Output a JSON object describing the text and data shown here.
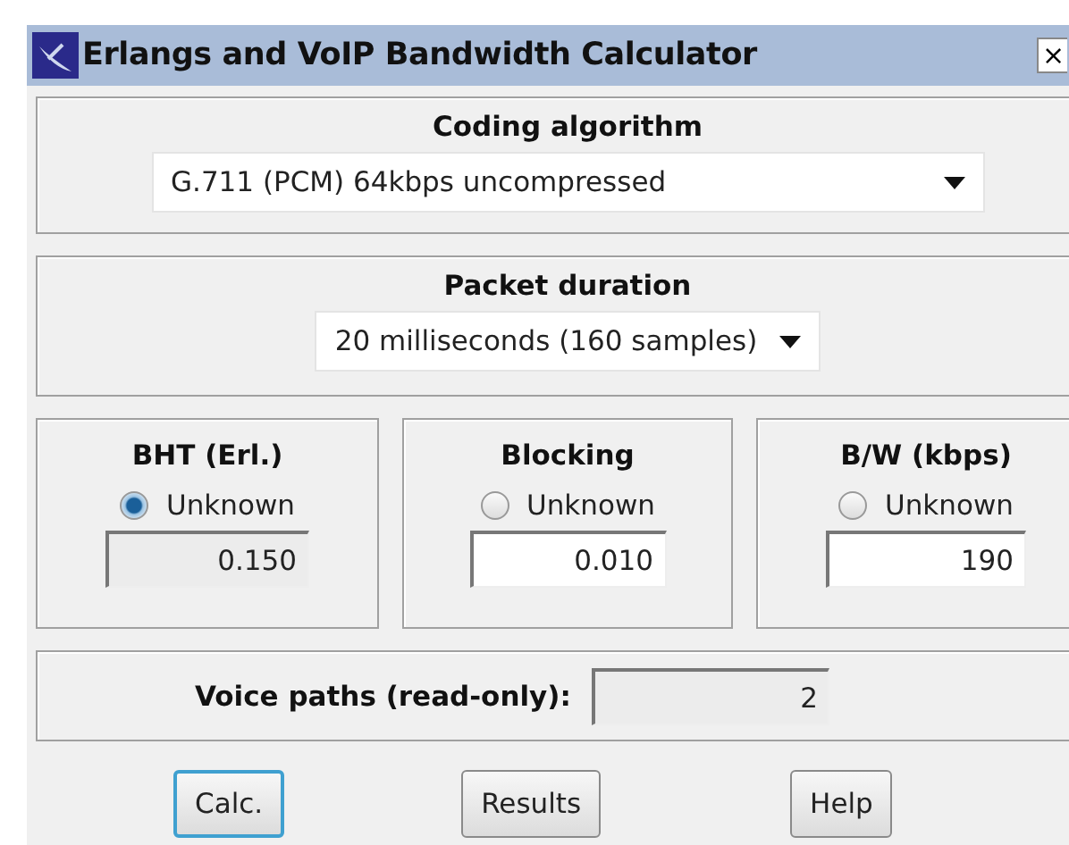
{
  "window": {
    "title": "Erlangs and VoIP Bandwidth Calculator",
    "close": "×"
  },
  "coding": {
    "label": "Coding algorithm",
    "value": "G.711 (PCM) 64kbps uncompressed"
  },
  "packet": {
    "label": "Packet duration",
    "value": "20 milliseconds (160 samples)"
  },
  "groups": [
    {
      "label": "BHT (Erl.)",
      "radio": "Unknown",
      "selected": true,
      "value": "0.150",
      "disabled": true
    },
    {
      "label": "Blocking",
      "radio": "Unknown",
      "selected": false,
      "value": "0.010",
      "disabled": false
    },
    {
      "label": "B/W (kbps)",
      "radio": "Unknown",
      "selected": false,
      "value": "190",
      "disabled": false
    }
  ],
  "voice_paths": {
    "label": "Voice paths (read-only):",
    "value": "2"
  },
  "buttons": [
    {
      "label": "Calc.",
      "focused": true
    },
    {
      "label": "Results",
      "focused": false
    },
    {
      "label": "Help",
      "focused": false
    }
  ]
}
